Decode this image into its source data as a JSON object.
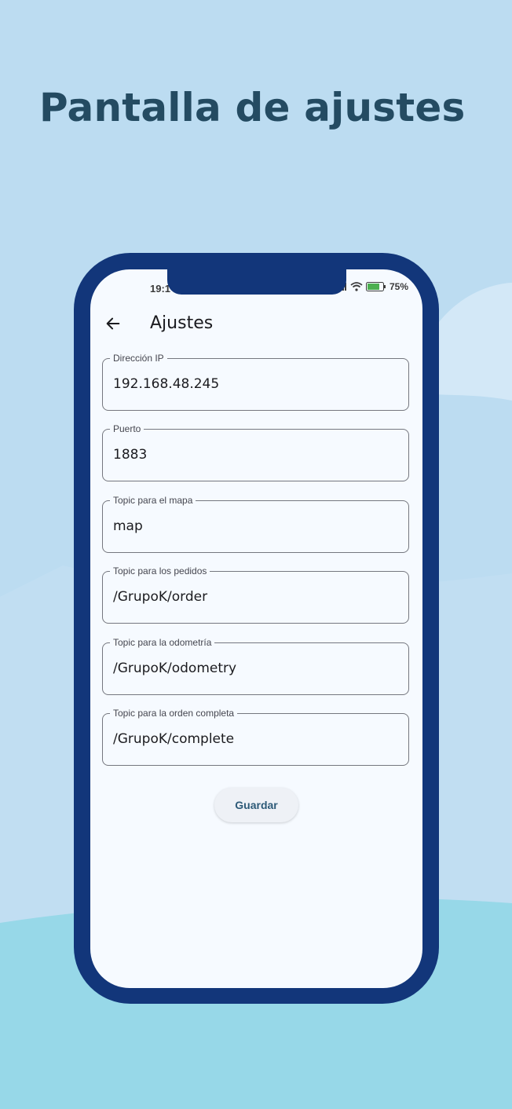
{
  "page": {
    "headline": "Pantalla de ajustes"
  },
  "status_bar": {
    "time": "19:1",
    "battery": "75%"
  },
  "appbar": {
    "title": "Ajustes"
  },
  "fields": [
    {
      "label": "Dirección IP",
      "value": "192.168.48.245"
    },
    {
      "label": "Puerto",
      "value": "1883"
    },
    {
      "label": "Topic para el mapa",
      "value": "map"
    },
    {
      "label": "Topic para los pedidos",
      "value": "/GrupoK/order"
    },
    {
      "label": "Topic para la odometría",
      "value": "/GrupoK/odometry"
    },
    {
      "label": "Topic para la orden completa",
      "value": "/GrupoK/complete"
    }
  ],
  "actions": {
    "save_label": "Guardar"
  },
  "colors": {
    "background": "#bcdcf1",
    "phone_frame": "#12367a",
    "headline": "#244b62",
    "screen": "#f6faff"
  }
}
